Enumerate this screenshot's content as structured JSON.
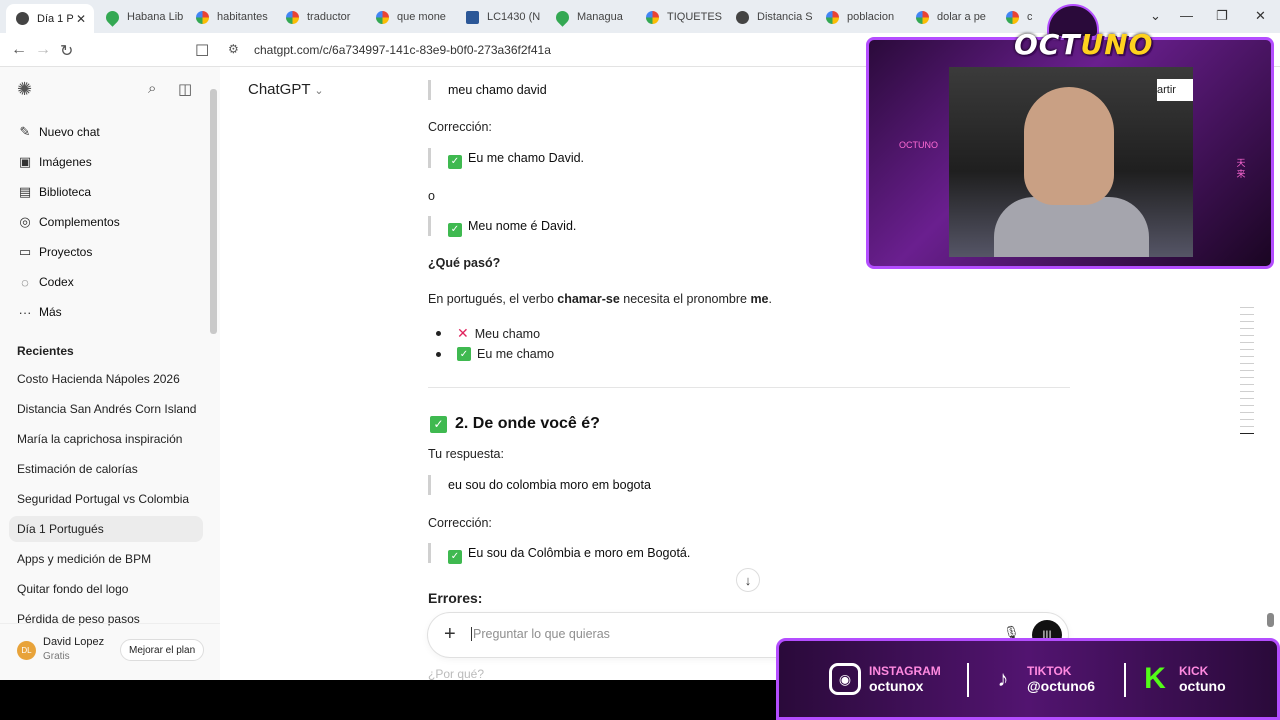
{
  "browser": {
    "tabs": [
      {
        "title": "Día 1 P",
        "fav": "gpt",
        "active": true
      },
      {
        "title": "Habana Lib",
        "fav": "map"
      },
      {
        "title": "habitantes",
        "fav": "g"
      },
      {
        "title": "traductor",
        "fav": "g"
      },
      {
        "title": "que mone",
        "fav": "g"
      },
      {
        "title": "LC1430 (N",
        "fav": "doc"
      },
      {
        "title": "Managua",
        "fav": "map"
      },
      {
        "title": "TIQUETES",
        "fav": "g"
      },
      {
        "title": "Distancia S",
        "fav": "gpt"
      },
      {
        "title": "poblacion",
        "fav": "g"
      },
      {
        "title": "dolar a pe",
        "fav": "g"
      },
      {
        "title": "cl",
        "fav": "g"
      }
    ],
    "url": "chatgpt.com/c/6a734997-141c-83e9-b0f0-273a36f2f41a"
  },
  "sidebar": {
    "nav": [
      {
        "label": "Nuevo chat",
        "icon": "✎"
      },
      {
        "label": "Imágenes",
        "icon": "▣"
      },
      {
        "label": "Biblioteca",
        "icon": "▤"
      },
      {
        "label": "Complementos",
        "icon": "◎"
      },
      {
        "label": "Proyectos",
        "icon": "▭"
      },
      {
        "label": "Codex",
        "icon": "◌"
      },
      {
        "label": "Más",
        "icon": "···"
      }
    ],
    "recent_label": "Recientes",
    "chats": [
      "Costo Hacienda Nápoles 2026",
      "Distancia San Andrés Corn Island",
      "María la caprichosa inspiración",
      "Estimación de calorías",
      "Seguridad Portugal vs Colombia",
      "Día 1 Portugués",
      "Apps y medición de BPM",
      "Quitar fondo del logo",
      "Pérdida de peso pasos"
    ],
    "active_chat": 5,
    "user": {
      "initials": "DL",
      "name": "David Lopez",
      "plan": "Gratis",
      "upgrade": "Mejorar el plan"
    }
  },
  "main": {
    "model": "ChatGPT",
    "quote1": "meu chamo david",
    "correction_label": "Corrección:",
    "fix1": "Eu me chamo David.",
    "or": "o",
    "fix2": "Meu nome é David.",
    "what_happened": "¿Qué pasó?",
    "explain_pre": "En portugués, el verbo ",
    "explain_verb": "chamar-se",
    "explain_mid": " necesita el pronombre ",
    "explain_pron": "me",
    "explain_end": ".",
    "wrong": "Meu chamo",
    "right": "Eu me chamo",
    "section_title": "2. De onde você é?",
    "your_answer": "Tu respuesta:",
    "quote2": "eu sou do colombia moro em bogota",
    "correction_label2": "Corrección:",
    "fix3": "Eu sou da Colômbia e moro em Bogotá.",
    "errors": "Errores:",
    "placeholder": "Preguntar lo que quieras",
    "faded": "¿Por qué?"
  },
  "overlay": {
    "brand_a": "OCT",
    "brand_b": "UNO",
    "behind_text": "artir",
    "left_tag": "OCTUNO",
    "right_tag": "天来",
    "instagram_name": "INSTAGRAM",
    "instagram_handle": "octunox",
    "tiktok_name": "TIKTOK",
    "tiktok_handle": "@octuno6",
    "kick_name": "KICK",
    "kick_handle": "octuno"
  },
  "colors": {
    "accent_green": "#3fb950",
    "overlay_purple": "#b44dff"
  }
}
